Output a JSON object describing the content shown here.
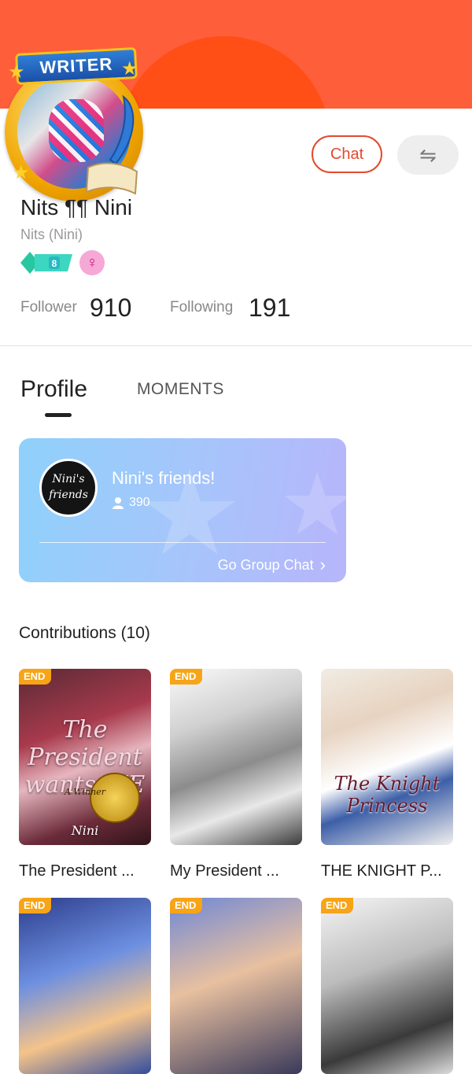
{
  "profile": {
    "badge": "WRITER",
    "name": "Nits ¶¶ Nini",
    "nickname": "Nits (Nini)",
    "level": "8",
    "gender_icon": "female-symbol-icon",
    "gender_symbol": "♀",
    "follower_label": "Follower",
    "follower_count": "910",
    "following_label": "Following",
    "following_count": "191"
  },
  "actions": {
    "chat_label": "Chat",
    "share_icon": "⇋"
  },
  "tabs": {
    "profile": "Profile",
    "moments": "MOMENTS"
  },
  "group": {
    "avatar_text_1": "Nini's",
    "avatar_text_2": "friends",
    "name": "Nini's friends!",
    "member_count": "390",
    "go_label": "Go Group Chat",
    "go_arrow": "›"
  },
  "contributions": {
    "title": "Contributions (10)",
    "end_tag": "END",
    "books": [
      {
        "title": "The President ...",
        "cover_text": "The President wants ME",
        "author": "Nini",
        "seal": "A Winner"
      },
      {
        "title": "My President ..."
      },
      {
        "title": "THE KNIGHT P...",
        "cover_text": "The Knight Princess"
      },
      {
        "title": ""
      },
      {
        "title": ""
      },
      {
        "title": ""
      }
    ]
  },
  "colors": {
    "banner": "#ff5e3a",
    "accent": "#e24a2e",
    "end_tag": "#f7a417"
  }
}
